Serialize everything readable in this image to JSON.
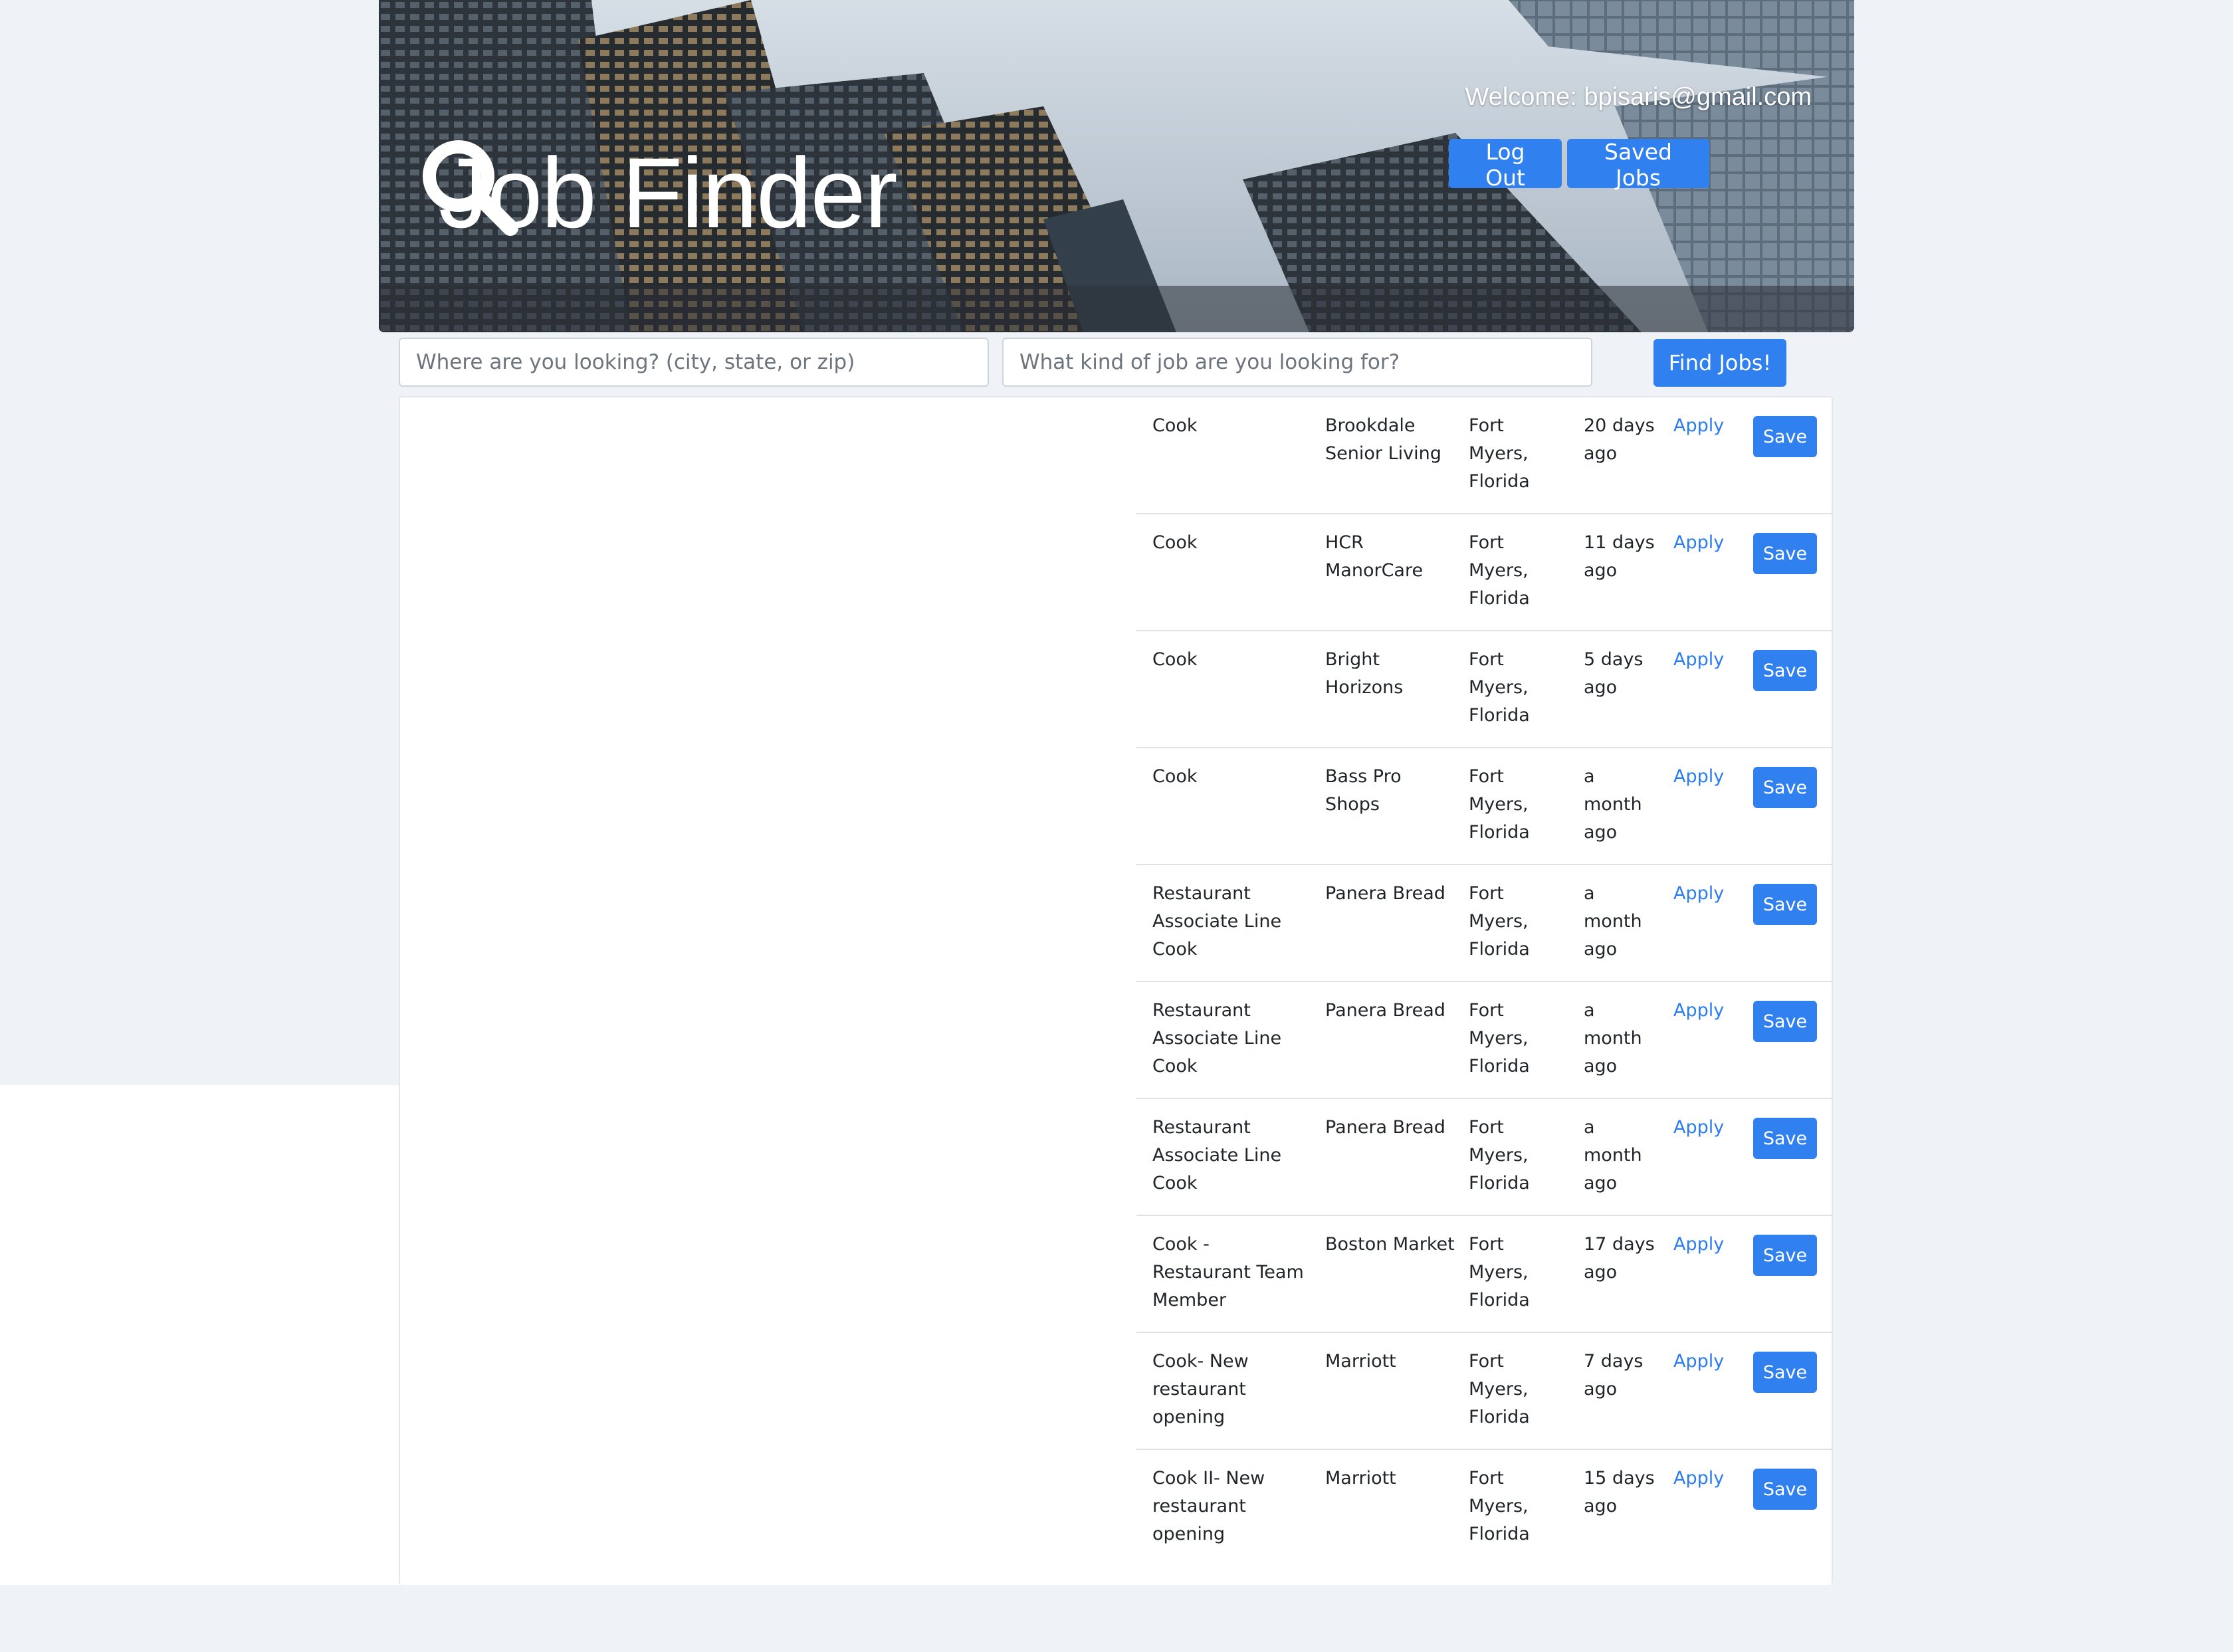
{
  "header": {
    "app_title": "Job Finder",
    "welcome": "Welcome: bpisaris@gmail.com",
    "logout_label": "Log Out",
    "saved_jobs_label": "Saved Jobs",
    "logo_icon": "search-icon"
  },
  "search": {
    "location_placeholder": "Where are you looking? (city, state, or zip)",
    "location_value": "",
    "job_placeholder": "What kind of job are you looking for?",
    "job_value": "",
    "find_label": "Find Jobs!"
  },
  "jobs": [
    {
      "title": "Cook",
      "company": "Brookdale Senior Living",
      "location": "Fort Myers, Florida",
      "posted": "20 days ago",
      "apply": "Apply",
      "save": "Save"
    },
    {
      "title": "Cook",
      "company": "HCR ManorCare",
      "location": "Fort Myers, Florida",
      "posted": "11 days ago",
      "apply": "Apply",
      "save": "Save"
    },
    {
      "title": "Cook",
      "company": "Bright Horizons",
      "location": "Fort Myers, Florida",
      "posted": "5 days ago",
      "apply": "Apply",
      "save": "Save"
    },
    {
      "title": "Cook",
      "company": "Bass Pro Shops",
      "location": "Fort Myers, Florida",
      "posted": "a month ago",
      "apply": "Apply",
      "save": "Save"
    },
    {
      "title": "Restaurant Associate Line Cook",
      "company": "Panera Bread",
      "location": "Fort Myers, Florida",
      "posted": "a month ago",
      "apply": "Apply",
      "save": "Save"
    },
    {
      "title": "Restaurant Associate Line Cook",
      "company": "Panera Bread",
      "location": "Fort Myers, Florida",
      "posted": "a month ago",
      "apply": "Apply",
      "save": "Save"
    },
    {
      "title": "Restaurant Associate Line Cook",
      "company": "Panera Bread",
      "location": "Fort Myers, Florida",
      "posted": "a month ago",
      "apply": "Apply",
      "save": "Save"
    },
    {
      "title": "Cook - Restaurant Team Member",
      "company": "Boston Market",
      "location": "Fort Myers, Florida",
      "posted": "17 days ago",
      "apply": "Apply",
      "save": "Save"
    },
    {
      "title": "Cook- New restaurant opening",
      "company": "Marriott",
      "location": "Fort Myers, Florida",
      "posted": "7 days ago",
      "apply": "Apply",
      "save": "Save"
    },
    {
      "title": "Cook II- New restaurant opening",
      "company": "Marriott",
      "location": "Fort Myers, Florida",
      "posted": "15 days ago",
      "apply": "Apply",
      "save": "Save"
    }
  ],
  "colors": {
    "accent": "#3180f0",
    "link": "#2a7cf0",
    "page_bg": "#eff3f7"
  }
}
